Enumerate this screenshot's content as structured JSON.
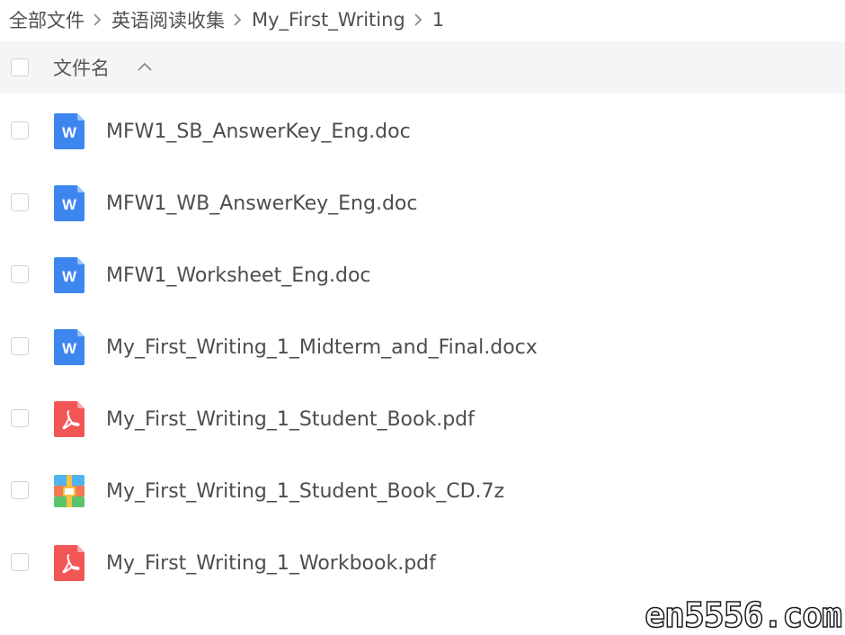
{
  "breadcrumb": {
    "items": [
      {
        "label": "全部文件"
      },
      {
        "label": "英语阅读收集"
      },
      {
        "label": "My_First_Writing"
      },
      {
        "label": "1"
      }
    ]
  },
  "header": {
    "column_label": "文件名",
    "sort_icon": "chevron-up-icon"
  },
  "files": [
    {
      "name": "MFW1_SB_AnswerKey_Eng.doc",
      "type": "word",
      "icon": "word-file-icon"
    },
    {
      "name": "MFW1_WB_AnswerKey_Eng.doc",
      "type": "word",
      "icon": "word-file-icon"
    },
    {
      "name": "MFW1_Worksheet_Eng.doc",
      "type": "word",
      "icon": "word-file-icon"
    },
    {
      "name": "My_First_Writing_1_Midterm_and_Final.docx",
      "type": "word",
      "icon": "word-file-icon"
    },
    {
      "name": "My_First_Writing_1_Student_Book.pdf",
      "type": "pdf",
      "icon": "pdf-file-icon"
    },
    {
      "name": "My_First_Writing_1_Student_Book_CD.7z",
      "type": "archive",
      "icon": "archive-file-icon"
    },
    {
      "name": "My_First_Writing_1_Workbook.pdf",
      "type": "pdf",
      "icon": "pdf-file-icon"
    }
  ],
  "watermark": {
    "text": "en5556.com"
  },
  "colors": {
    "word": "#3d86f0",
    "pdf": "#f35656",
    "header_bg": "#f4f5f7",
    "checkbox_border": "#cfd3d9"
  }
}
